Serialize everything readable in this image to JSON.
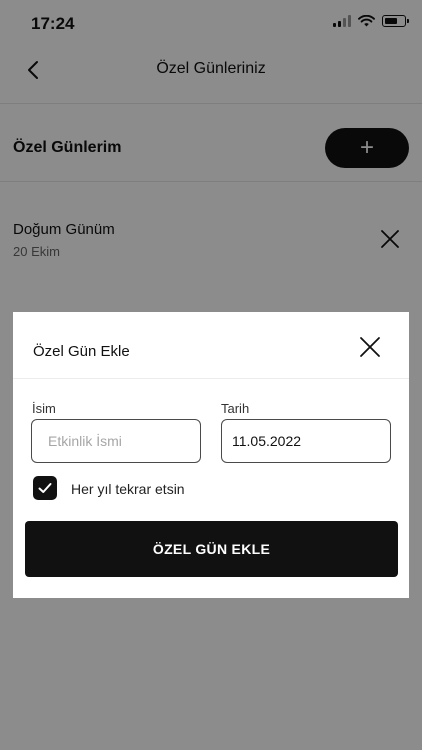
{
  "status_bar": {
    "time": "17:24"
  },
  "nav": {
    "title": "Özel Günleriniz"
  },
  "section": {
    "title": "Özel Günlerim",
    "add_label": "+"
  },
  "special_days": [
    {
      "title": "Doğum Günüm",
      "date": "20 Ekim"
    }
  ],
  "modal": {
    "title": "Özel Gün Ekle",
    "name_label": "İsim",
    "name_placeholder": "Etkinlik İsmi",
    "name_value": "",
    "date_label": "Tarih",
    "date_value": "11.05.2022",
    "repeat_label": "Her yıl tekrar etsin",
    "repeat_checked": true,
    "submit_label": "ÖZEL GÜN EKLE"
  },
  "colors": {
    "accent": "#111111",
    "overlay": "rgba(0,0,0,0.45)"
  }
}
